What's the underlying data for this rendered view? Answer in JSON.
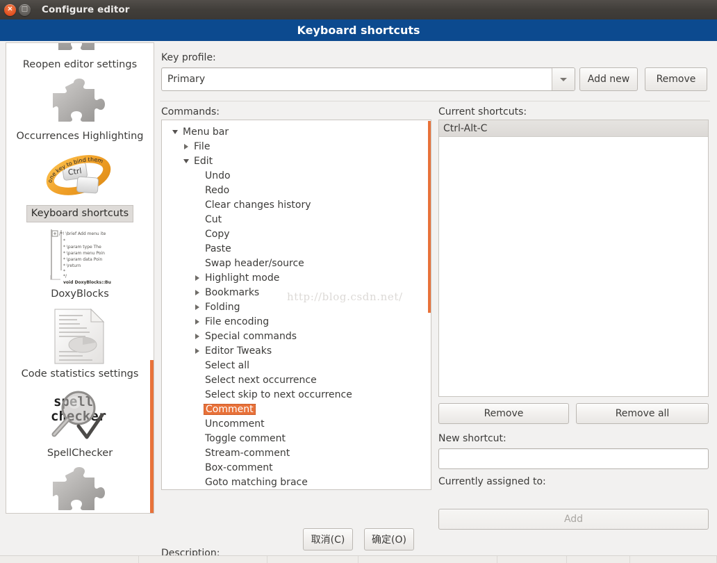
{
  "window": {
    "title": "Configure editor",
    "close_icon": "close-icon",
    "maximize_icon": "maximize-icon",
    "close_glyph": "×",
    "maximize_glyph": "□"
  },
  "header": {
    "title": "Keyboard shortcuts"
  },
  "sidebar": {
    "items": [
      {
        "label": "Reopen editor settings",
        "icon": "puzzle-icon",
        "selected": false
      },
      {
        "label": "Occurrences Highlighting",
        "icon": "puzzle-icon",
        "selected": false
      },
      {
        "label": "Keyboard shortcuts",
        "icon": "key-ring-icon",
        "selected": true
      },
      {
        "label": "DoxyBlocks",
        "icon": "code-comment-icon",
        "selected": false
      },
      {
        "label": "Code statistics settings",
        "icon": "statistics-document-icon",
        "selected": false
      },
      {
        "label": "SpellChecker",
        "icon": "spellchecker-magnifier-icon",
        "selected": false
      },
      {
        "label": "",
        "icon": "puzzle-icon",
        "selected": false
      }
    ],
    "ring_icon_text": {
      "key": "Ctrl",
      "curve": "one key to bind them"
    },
    "spell_icon_text": {
      "line1": "spell",
      "line2": "checker"
    },
    "code_icon_lines": [
      "/*! \\brief Add menu ite",
      "*",
      "* \\param type   The ",
      "* \\param menu  Poin",
      "* \\param data   Poin",
      "* \\return",
      "*",
      "*/",
      "void DoxyBlocks::Bu"
    ]
  },
  "main": {
    "key_profile_label": "Key profile:",
    "key_profile_value": "Primary",
    "key_profile_options": [
      "Primary"
    ],
    "add_new_label": "Add new",
    "remove_profile_label": "Remove",
    "commands_label": "Commands:",
    "current_shortcuts_label": "Current shortcuts:",
    "watermark": "http://blog.csdn.net/",
    "tree": [
      {
        "label": "Menu bar",
        "depth": 0,
        "twisty": "down",
        "selected": false
      },
      {
        "label": "File",
        "depth": 1,
        "twisty": "right",
        "selected": false
      },
      {
        "label": "Edit",
        "depth": 1,
        "twisty": "down",
        "selected": false
      },
      {
        "label": "Undo",
        "depth": 2,
        "twisty": "none",
        "selected": false
      },
      {
        "label": "Redo",
        "depth": 2,
        "twisty": "none",
        "selected": false
      },
      {
        "label": "Clear changes history",
        "depth": 2,
        "twisty": "none",
        "selected": false
      },
      {
        "label": "Cut",
        "depth": 2,
        "twisty": "none",
        "selected": false
      },
      {
        "label": "Copy",
        "depth": 2,
        "twisty": "none",
        "selected": false
      },
      {
        "label": "Paste",
        "depth": 2,
        "twisty": "none",
        "selected": false
      },
      {
        "label": "Swap header/source",
        "depth": 2,
        "twisty": "none",
        "selected": false
      },
      {
        "label": "Highlight mode",
        "depth": 2,
        "twisty": "right",
        "selected": false
      },
      {
        "label": "Bookmarks",
        "depth": 2,
        "twisty": "right",
        "selected": false
      },
      {
        "label": "Folding",
        "depth": 2,
        "twisty": "right",
        "selected": false
      },
      {
        "label": "File encoding",
        "depth": 2,
        "twisty": "right",
        "selected": false
      },
      {
        "label": "Special commands",
        "depth": 2,
        "twisty": "right",
        "selected": false
      },
      {
        "label": "Editor Tweaks",
        "depth": 2,
        "twisty": "right",
        "selected": false
      },
      {
        "label": "Select all",
        "depth": 2,
        "twisty": "none",
        "selected": false
      },
      {
        "label": "Select next occurrence",
        "depth": 2,
        "twisty": "none",
        "selected": false
      },
      {
        "label": "Select skip to next occurrence",
        "depth": 2,
        "twisty": "none",
        "selected": false
      },
      {
        "label": "Comment",
        "depth": 2,
        "twisty": "none",
        "selected": true
      },
      {
        "label": "Uncomment",
        "depth": 2,
        "twisty": "none",
        "selected": false
      },
      {
        "label": "Toggle comment",
        "depth": 2,
        "twisty": "none",
        "selected": false
      },
      {
        "label": "Stream-comment",
        "depth": 2,
        "twisty": "none",
        "selected": false
      },
      {
        "label": "Box-comment",
        "depth": 2,
        "twisty": "none",
        "selected": false
      },
      {
        "label": "Goto matching brace",
        "depth": 2,
        "twisty": "none",
        "selected": false
      }
    ],
    "current_shortcuts": [
      "Ctrl-Alt-C"
    ],
    "remove_label": "Remove",
    "remove_all_label": "Remove all",
    "new_shortcut_label": "New shortcut:",
    "new_shortcut_value": "",
    "new_shortcut_placeholder": "",
    "currently_assigned_label": "Currently assigned to:",
    "currently_assigned_value": "",
    "add_label": "Add",
    "add_enabled": false,
    "description_label": "Description:",
    "description_value": ""
  },
  "footer": {
    "cancel_label": "取消(C)",
    "ok_label": "确定(O)"
  },
  "colors": {
    "accent_orange": "#e8723a",
    "header_blue": "#0c4a8f",
    "titlebar": "#413e3a",
    "panel_bg": "#f2f1f0"
  }
}
